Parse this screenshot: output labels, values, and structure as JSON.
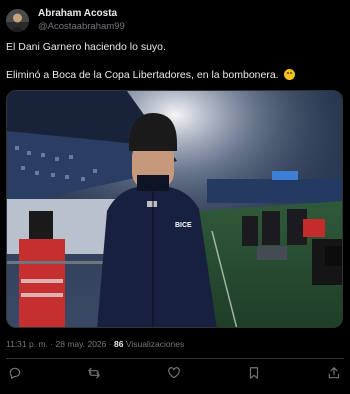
{
  "author": {
    "display_name": "Abraham Acosta",
    "handle": "@Acostaabraham99"
  },
  "post": {
    "text_line1": "El Dani Garnero haciendo lo suyo.",
    "text_line2": "Eliminó a Boca de la Copa Libertadores, en la bombonera."
  },
  "media": {
    "sponsor_text": "BICE"
  },
  "meta": {
    "time": "11:31 p. m.",
    "separator1": "·",
    "date": "28 may. 2026",
    "separator2": "·",
    "views_count": "86",
    "views_label": "Visualizaciones"
  },
  "actions": {
    "reply_icon": "reply-icon",
    "repost_icon": "repost-icon",
    "like_icon": "heart-icon",
    "bookmark_icon": "bookmark-icon",
    "share_icon": "share-icon"
  },
  "colors": {
    "background": "#000000",
    "text_primary": "#e7e9ea",
    "text_secondary": "#71767b",
    "border": "#2f3336"
  }
}
